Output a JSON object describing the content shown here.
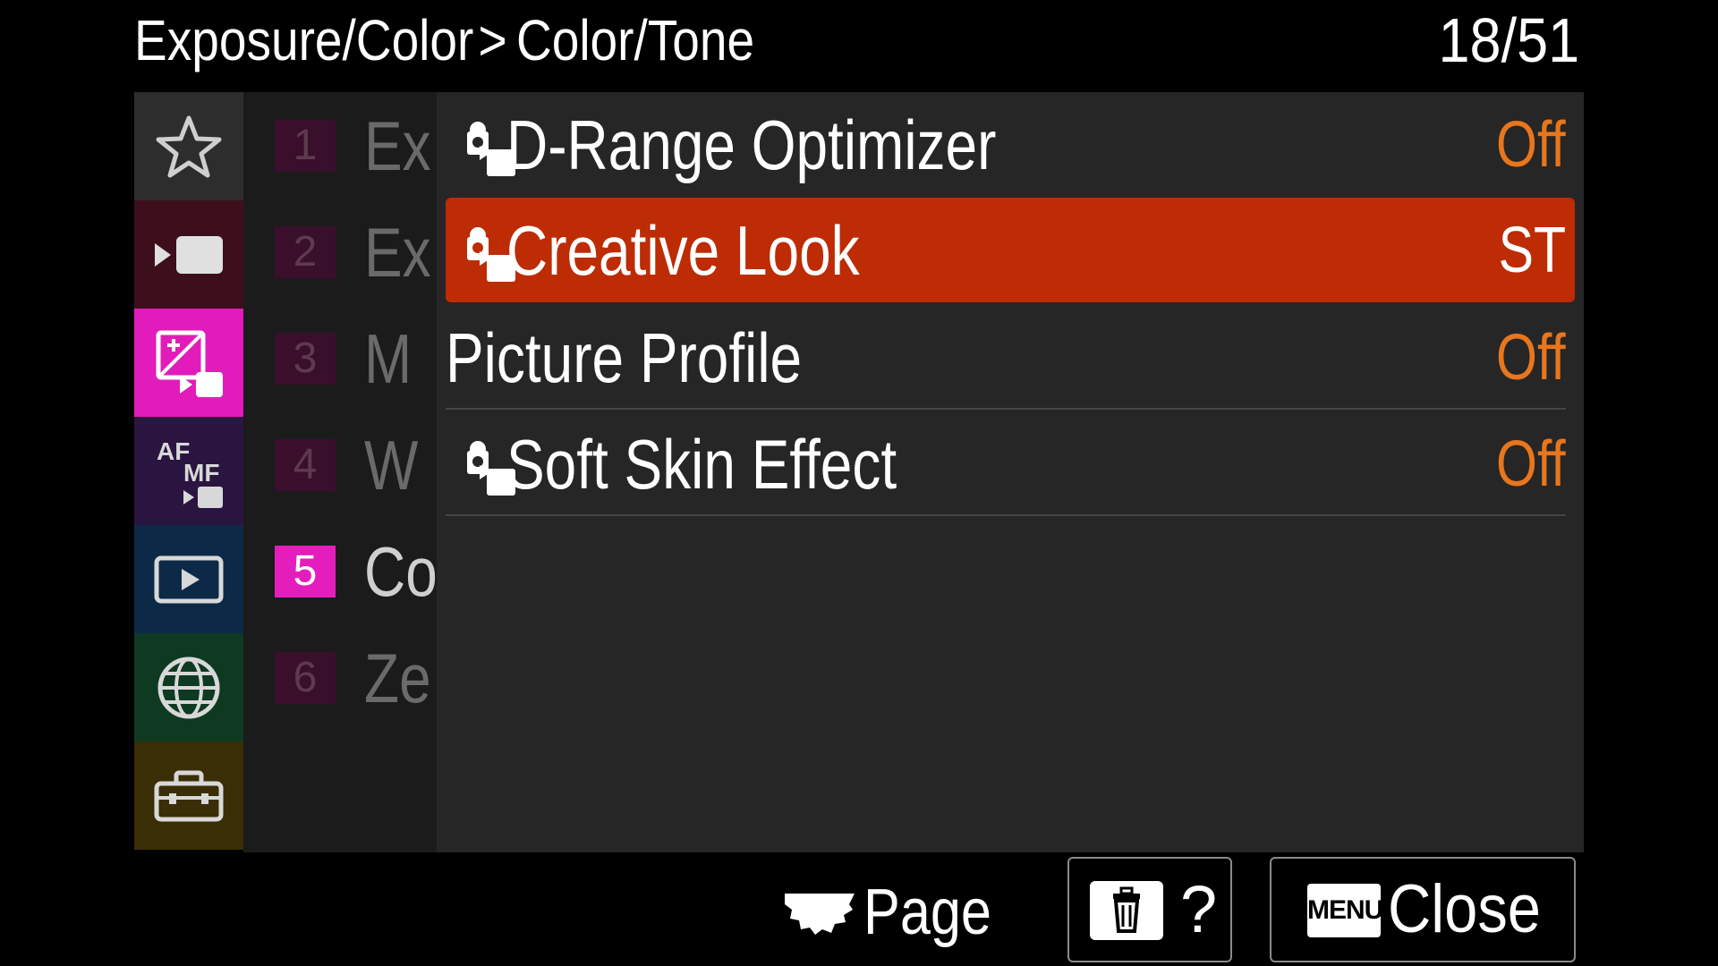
{
  "header": {
    "breadcrumb_parent": "Exposure/Color",
    "breadcrumb_separator": ">",
    "breadcrumb_current": "Color/Tone",
    "page_indicator": "18/51"
  },
  "categories": [
    {
      "icon": "star-icon",
      "color": "#2d2d2d"
    },
    {
      "icon": "movie-camera-icon",
      "color": "#3d0f1c"
    },
    {
      "icon": "exposure-color-icon",
      "color": "#e21cba",
      "selected": true
    },
    {
      "icon": "af-mf-icon",
      "color": "#2a1540"
    },
    {
      "icon": "playback-icon",
      "color": "#0c2a48"
    },
    {
      "icon": "network-globe-icon",
      "color": "#0e3a22"
    },
    {
      "icon": "toolbox-icon",
      "color": "#3a2e06"
    }
  ],
  "subpages": [
    {
      "number": "1",
      "label": "Ex"
    },
    {
      "number": "2",
      "label": "Ex"
    },
    {
      "number": "3",
      "label": "M"
    },
    {
      "number": "4",
      "label": "W"
    },
    {
      "number": "5",
      "label": "Co",
      "active": true
    },
    {
      "number": "6",
      "label": "Ze"
    }
  ],
  "items": [
    {
      "label": "D-Range Optimizer",
      "value": "Off",
      "icon": "photo-movie-icon"
    },
    {
      "label": "Creative Look",
      "value": "ST",
      "icon": "photo-movie-icon",
      "selected": true
    },
    {
      "label": "Picture Profile",
      "value": "Off"
    },
    {
      "label": "Soft Skin Effect",
      "value": "Off",
      "icon": "photo-movie-icon"
    }
  ],
  "footer": {
    "page_label": "Page",
    "help_label": "?",
    "menu_key_label": "MENU",
    "close_label": "Close"
  },
  "colors": {
    "accent_selected": "#bd2c05",
    "value_orange": "#e8761c",
    "active_subpage": "#e41ebd"
  }
}
